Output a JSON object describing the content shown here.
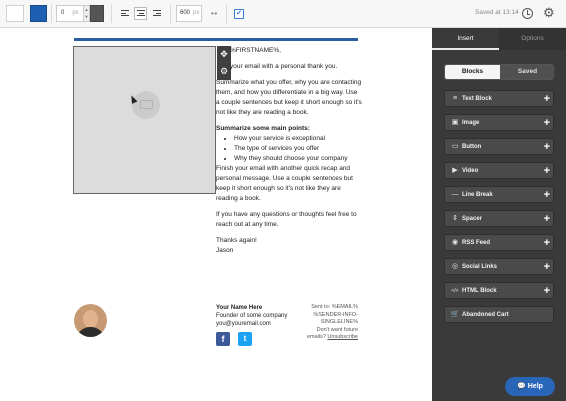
{
  "toolbar": {
    "padding_value": "0",
    "padding_unit": "px",
    "stepper_up": "▲",
    "stepper_down": "▼",
    "width_value": "600",
    "width_unit": "px",
    "expand_glyph": "↔",
    "check_glyph": "✔",
    "saved_text": "Saved at 13:14",
    "gear_glyph": "⚙",
    "colors": {
      "background": "#ffffff",
      "accent": "#1d5fb0",
      "text": "#555555"
    }
  },
  "canvas": {
    "side_tools": {
      "move_glyph": "✥",
      "gear_glyph": "⚙"
    },
    "body": {
      "greeting": "%FIRSTNAME%,",
      "intro": "your email with a personal thank you.",
      "summary": "Summarize what you offer, why you are contacting them, and how you differentiate in a big way. Use a couple sentences but keep it short enough so it's not like they are reading a book.",
      "points_heading": "Summarize some main points:",
      "points": [
        "How your service is exceptional",
        "The type of services you offer",
        "Why they should choose your company"
      ],
      "recap": "Finish your email with another quick recap and personal message. Use a couple sentences but keep it short enough so it's not like they are reading a book.",
      "questions": "If you have any questions or thoughts feel free to reach out at any time.",
      "thanks": "Thanks again!",
      "sender": "Jason"
    },
    "signature": {
      "name": "Your Name Here",
      "title": "Founder of some company",
      "email": "you@youremail.com"
    },
    "social": {
      "facebook": "f",
      "twitter": "t"
    },
    "footer": {
      "sent_to": "Sent to: %EMAIL%",
      "sender_info_1": "%SENDER-INFO-",
      "sender_info_2": "SINGLELINE%",
      "dont_want": "Don't want future",
      "emails": "emails?",
      "unsubscribe": "Unsubscribe"
    }
  },
  "panel": {
    "tabs": [
      "Insert",
      "Options"
    ],
    "segments": [
      "Blocks",
      "Saved"
    ],
    "blocks": [
      {
        "label": "Text Block",
        "icon": "≡",
        "plus": "+"
      },
      {
        "label": "Image",
        "icon": "▣",
        "plus": "+"
      },
      {
        "label": "Button",
        "icon": "▭",
        "plus": "+"
      },
      {
        "label": "Video",
        "icon": "▶",
        "plus": "+"
      },
      {
        "label": "Line Break",
        "icon": "—",
        "plus": "+"
      },
      {
        "label": "Spacer",
        "icon": "⇕",
        "plus": "+"
      },
      {
        "label": "RSS Feed",
        "icon": "◉",
        "plus": "+"
      },
      {
        "label": "Social Links",
        "icon": "◎",
        "plus": "+"
      },
      {
        "label": "HTML Block",
        "icon": "</>",
        "plus": "+"
      },
      {
        "label": "Abandoned Cart",
        "icon": "🛒",
        "plus": ""
      }
    ]
  },
  "help": {
    "label": "Help",
    "icon": "💬"
  }
}
